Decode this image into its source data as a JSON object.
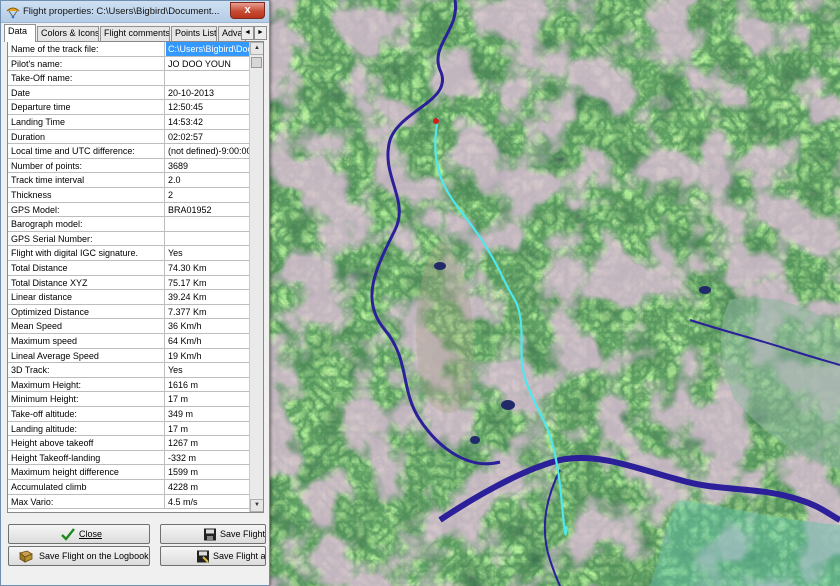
{
  "window": {
    "title": "Flight properties: C:\\Users\\Bigbird\\Document...",
    "close_glyph": "x"
  },
  "tabs": [
    "Data",
    "Colors & Icons",
    "Flight comments:",
    "Points List",
    "Adva"
  ],
  "tab_arrows": [
    "◄",
    "►"
  ],
  "scrollbar": {
    "up": "▲",
    "down": "▼"
  },
  "properties": [
    {
      "label": "Name of the track file:",
      "value": "C:\\Users\\Bigbird\\Docu"
    },
    {
      "label": "Pilot's name:",
      "value": "JO DOO YOUN"
    },
    {
      "label": "Take-Off name:",
      "value": ""
    },
    {
      "label": "Date",
      "value": "20-10-2013"
    },
    {
      "label": "Departure time",
      "value": "12:50:45"
    },
    {
      "label": "Landing Time",
      "value": "14:53:42"
    },
    {
      "label": "Duration",
      "value": "02:02:57"
    },
    {
      "label": "Local time and UTC difference:",
      "value": "(not defined)-9:00:00"
    },
    {
      "label": "Number of points:",
      "value": "3689"
    },
    {
      "label": "Track time interval",
      "value": "2.0"
    },
    {
      "label": "Thickness",
      "value": "2"
    },
    {
      "label": "GPS Model:",
      "value": "BRA01952"
    },
    {
      "label": "Barograph model:",
      "value": ""
    },
    {
      "label": "GPS Serial Number:",
      "value": ""
    },
    {
      "label": "Flight with digital IGC signature.",
      "value": "Yes"
    },
    {
      "label": "Total Distance",
      "value": "74.30 Km"
    },
    {
      "label": "Total Distance XYZ",
      "value": "75.17 Km"
    },
    {
      "label": "Linear distance",
      "value": "39.24 Km"
    },
    {
      "label": "Optimized Distance",
      "value": "7.377 Km"
    },
    {
      "label": "Mean Speed",
      "value": "36 Km/h"
    },
    {
      "label": "Maximum speed",
      "value": "64 Km/h"
    },
    {
      "label": "Lineal Average Speed",
      "value": "19 Km/h"
    },
    {
      "label": "3D Track:",
      "value": "Yes"
    },
    {
      "label": "Maximum Height:",
      "value": "1616 m"
    },
    {
      "label": "Minimum Height:",
      "value": "17 m"
    },
    {
      "label": "Take-off altitude:",
      "value": "349 m"
    },
    {
      "label": "Landing altitude:",
      "value": "17 m"
    },
    {
      "label": "Height above takeoff",
      "value": "1267 m"
    },
    {
      "label": "Height Takeoff-landing",
      "value": "-332 m"
    },
    {
      "label": "Maximum height difference",
      "value": "1599 m"
    },
    {
      "label": "Accumulated climb",
      "value": "4228 m"
    },
    {
      "label": "Max Vario:",
      "value": "4.5 m/s"
    }
  ],
  "buttons": {
    "close": "Close",
    "save_flight": "Save Flight",
    "save_logbook": "Save Flight on the Logbook",
    "save_as": "Save Flight as..."
  },
  "colors": {
    "track": "#4ee8ee",
    "river": "#2b1f9a",
    "selection": "#3399ff"
  }
}
